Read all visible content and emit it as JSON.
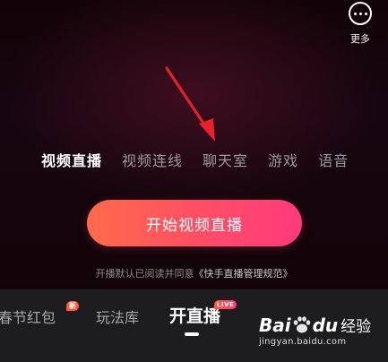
{
  "more": {
    "label": "更多",
    "icon": "more-dots-icon"
  },
  "mode_tabs": [
    {
      "label": "视频直播",
      "active": true
    },
    {
      "label": "视频连线",
      "active": false
    },
    {
      "label": "聊天室",
      "active": false
    },
    {
      "label": "游戏",
      "active": false
    },
    {
      "label": "语音",
      "active": false
    }
  ],
  "start_button": {
    "label": "开始视频直播"
  },
  "agreement": {
    "prefix": "开播默认已阅读并同意",
    "link": "《快手直播管理规范》"
  },
  "bottom_nav": {
    "items": [
      {
        "label": "春节红包",
        "badge": "新"
      },
      {
        "label": "玩法库"
      },
      {
        "label": "开直播",
        "badge": "LIVE",
        "active": true
      }
    ]
  },
  "watermark": {
    "brand_left": "Bai",
    "brand_right": "du",
    "suffix": "经验",
    "url": "jingyan.baidu.com"
  },
  "colors": {
    "accent_start": "#ff6a4a",
    "accent_end": "#ff3a7c",
    "annotation_arrow": "#e8202a",
    "nav_background": "#1d1d20"
  }
}
